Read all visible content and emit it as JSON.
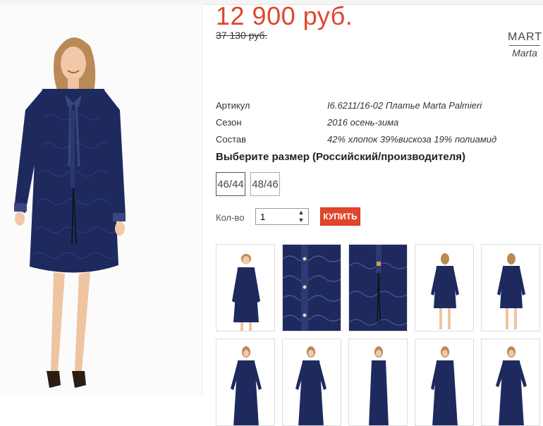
{
  "product": {
    "price": "12 900 руб.",
    "old_price": "37 130 руб.",
    "brand_top": "MARTY",
    "brand_bottom": "Marta"
  },
  "specs": [
    {
      "label": "Артикул",
      "value": "I6.6211/16-02 Платье Marta Palmieri"
    },
    {
      "label": "Сезон",
      "value": "2016 осень-зима"
    },
    {
      "label": "Состав",
      "value": "42% хлопок 39%вискоза 19% полиамид"
    }
  ],
  "size_title": "Выберите размер (Российский/производителя)",
  "sizes": [
    "46/44",
    "48/46"
  ],
  "quantity": {
    "label": "Кол-во",
    "value": "1"
  },
  "buy_label": "КУПИТЬ",
  "colors": {
    "price": "#e0462b",
    "buy_button": "#e0462b",
    "dress": "#1e2a5e"
  }
}
